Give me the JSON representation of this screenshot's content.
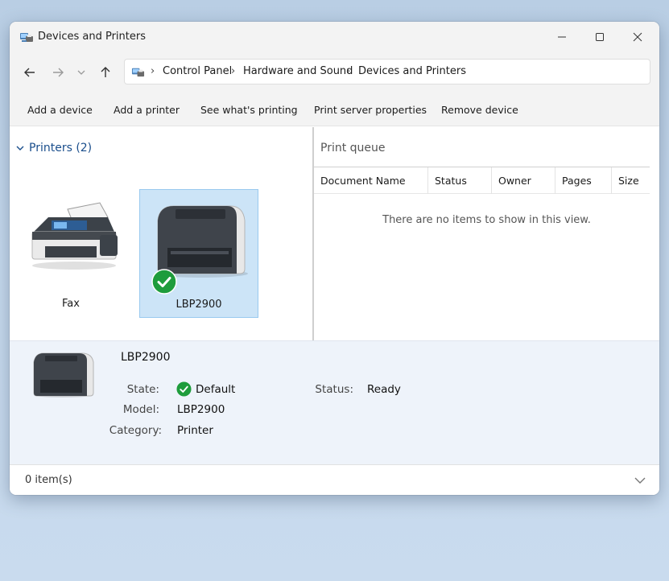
{
  "window": {
    "title": "Devices and Printers"
  },
  "navigation": {
    "breadcrumbs": [
      "Control Panel",
      "Hardware and Sound",
      "Devices and Printers"
    ]
  },
  "commands": [
    "Add a device",
    "Add a printer",
    "See what's printing",
    "Print server properties",
    "Remove device"
  ],
  "printers_group": {
    "title": "Printers (2)",
    "devices": [
      {
        "label": "Fax",
        "icon": "fax-icon",
        "selected": false
      },
      {
        "label": "LBP2900",
        "icon": "printer-icon",
        "selected": true,
        "default": true
      }
    ]
  },
  "print_queue": {
    "title": "Print queue",
    "columns": [
      "Document Name",
      "Status",
      "Owner",
      "Pages",
      "Size"
    ],
    "empty_message": "There are no items to show in this view."
  },
  "details": {
    "name": "LBP2900",
    "state_label": "State:",
    "state_value": "Default",
    "model_label": "Model:",
    "model_value": "LBP2900",
    "category_label": "Category:",
    "category_value": "Printer",
    "status_label": "Status:",
    "status_value": "Ready"
  },
  "statusbar": {
    "item_count": "0 item(s)"
  },
  "colors": {
    "accent": "#1a4e8c",
    "selection": "#cce4f7",
    "check_green": "#1e9c3c"
  }
}
